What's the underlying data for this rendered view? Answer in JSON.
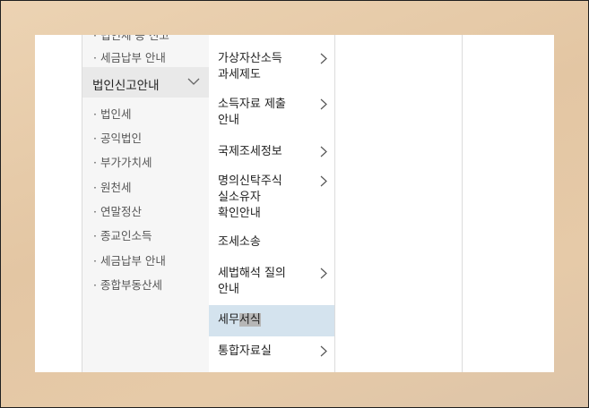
{
  "left_menu": {
    "prev_item": "· 세금납부 안내",
    "group_label": "법인신고안내",
    "items": [
      "· 법인세",
      "· 공익법인",
      "· 부가가치세",
      "· 원천세",
      "· 연말정산",
      "· 종교인소득",
      "· 세금납부 안내",
      "· 종합부동산세"
    ]
  },
  "mid_menu": {
    "items": [
      {
        "line1": "가상자산소득",
        "line2": "과세제도",
        "line3": ""
      },
      {
        "line1": "소득자료 제출",
        "line2": "안내",
        "line3": ""
      },
      {
        "line1": "국제조세정보",
        "line2": "",
        "line3": ""
      },
      {
        "line1": "명의신탁주식",
        "line2": "실소유자",
        "line3": "확인안내"
      },
      {
        "line1": "조세소송",
        "line2": "",
        "line3": ""
      },
      {
        "line1": "세법해석 질의",
        "line2": "안내",
        "line3": ""
      },
      {
        "line1": "세무",
        "line1_selected": "서식",
        "line2": "",
        "line3": ""
      },
      {
        "line1": "통합자료실",
        "line2": "",
        "line3": ""
      }
    ]
  },
  "icons": {
    "group_toggle": "chevron-down-icon",
    "submenu": "chevron-right-icon"
  },
  "colors": {
    "active_row": "#d4e3ee",
    "group_bg": "#e9e9e9",
    "left_bg": "#f6f6f6"
  }
}
